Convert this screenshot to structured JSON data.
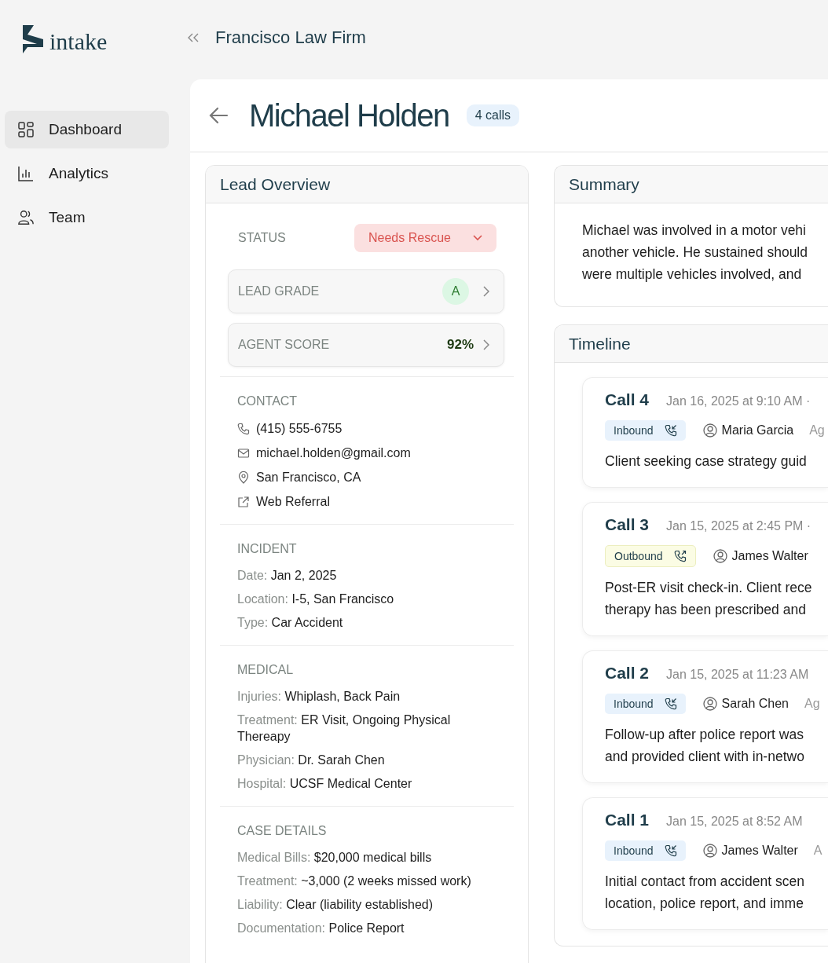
{
  "brand": {
    "name": "intake"
  },
  "header": {
    "title": "Francisco Law Firm"
  },
  "sidebar": {
    "items": [
      {
        "label": "Dashboard",
        "selected": true
      },
      {
        "label": "Analytics",
        "selected": false
      },
      {
        "label": "Team",
        "selected": false
      }
    ]
  },
  "lead": {
    "name": "Michael Holden",
    "call_count": "4 calls"
  },
  "lead_overview": {
    "title": "Lead Overview",
    "status": {
      "label": "STATUS",
      "value": "Needs Rescue"
    },
    "metrics": [
      {
        "kind": "grade",
        "label": "LEAD GRADE",
        "value": "A"
      },
      {
        "kind": "score",
        "label": "AGENT SCORE",
        "value": "92%"
      }
    ],
    "sections": [
      {
        "kind": "contact",
        "heading": "CONTACT",
        "items": [
          {
            "text": "(415) 555-6755"
          },
          {
            "text": "michael.holden@gmail.com"
          },
          {
            "text": "San Francisco, CA"
          },
          {
            "text": "Web Referral"
          }
        ]
      },
      {
        "kind": "fields",
        "heading": "INCIDENT",
        "items": [
          {
            "label": "Date:",
            "value": "Jan 2, 2025"
          },
          {
            "label": "Location:",
            "value": "I-5, San Francisco"
          },
          {
            "label": "Type:",
            "value": "Car Accident"
          }
        ]
      },
      {
        "kind": "fields",
        "heading": "MEDICAL",
        "items": [
          {
            "label": "Injuries:",
            "value": "Whiplash, Back Pain"
          },
          {
            "label": "Treatment:",
            "value": "ER Visit, Ongoing Physical Thereapy"
          },
          {
            "label": "Physician:",
            "value": "Dr. Sarah Chen"
          },
          {
            "label": "Hospital:",
            "value": "UCSF Medical Center"
          }
        ]
      },
      {
        "kind": "fields",
        "heading": "CASE DETAILS",
        "items": [
          {
            "label": "Medical Bills:",
            "value": "$20,000 medical bills"
          },
          {
            "label": "Treatment:",
            "value": "~3,000 (2 weeks missed work)"
          },
          {
            "label": "Liability:",
            "value": "Clear (liability established)"
          },
          {
            "label": "Documentation:",
            "value": "Police Report"
          }
        ]
      }
    ]
  },
  "summary": {
    "title": "Summary",
    "lines": [
      "Michael was involved in a motor vehi",
      "another vehicle. He sustained should",
      "were multiple vehicles involved, and"
    ]
  },
  "timeline": {
    "title": "Timeline",
    "calls": [
      {
        "title": "Call 4",
        "meta": "Jan 16, 2025 at 9:10 AM ·",
        "kind": "inbound",
        "direction": "Inbound",
        "agent": "Maria Garcia",
        "extra": "Ag",
        "lines": [
          "Client seeking case strategy guid"
        ]
      },
      {
        "title": "Call 3",
        "meta": "Jan 15, 2025 at 2:45 PM ·",
        "kind": "outbound",
        "direction": "Outbound",
        "agent": "James Walter",
        "lines": [
          "Post-ER visit check-in. Client rece",
          "therapy has been prescribed and"
        ]
      },
      {
        "title": "Call 2",
        "meta": "Jan 15, 2025 at 11:23 AM",
        "kind": "inbound",
        "direction": "Inbound",
        "agent": "Sarah Chen",
        "extra": "Ag",
        "lines": [
          "Follow-up after police report was",
          "and provided client with in-netwo"
        ]
      },
      {
        "title": "Call 1",
        "meta": "Jan 15, 2025 at 8:52 AM",
        "kind": "inbound",
        "direction": "Inbound",
        "agent": "James Walter",
        "extra": "A",
        "lines": [
          "Initial contact from accident scen",
          "location, police report, and imme"
        ]
      }
    ]
  }
}
